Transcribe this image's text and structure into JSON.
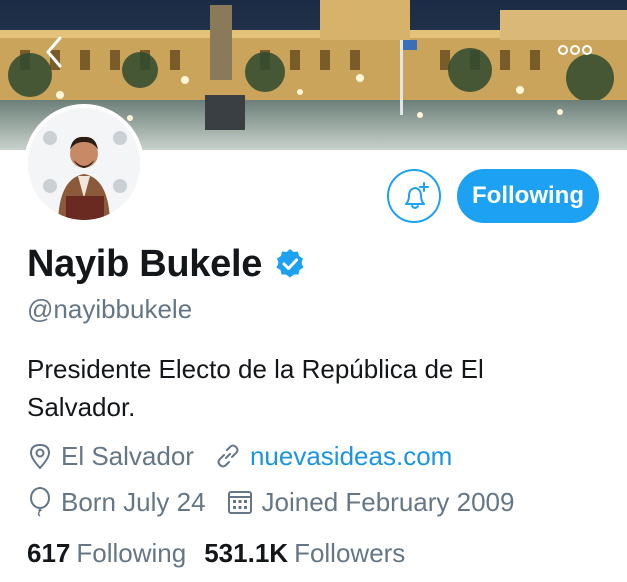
{
  "profile": {
    "display_name": "Nayib Bukele",
    "handle": "@nayibbukele",
    "bio": "Presidente Electo de la República de El Salvador.",
    "location": "El Salvador",
    "website": "nuevasideas.com",
    "born": "Born July 24",
    "joined": "Joined February 2009"
  },
  "actions": {
    "follow_label": "Following"
  },
  "stats": {
    "following_count": "617",
    "following_label": "Following",
    "followers_count": "531.1K",
    "followers_label": "Followers"
  },
  "icons": {
    "back": "chevron-left-icon",
    "more": "more-horizontal-icon",
    "notify": "bell-plus-icon",
    "verified": "verified-badge-icon",
    "location": "location-pin-icon",
    "link": "link-icon",
    "birthday": "balloon-icon",
    "calendar": "calendar-icon"
  },
  "colors": {
    "accent": "#1da1f2",
    "link": "#1b95e0",
    "text": "#14171a",
    "secondary": "#657786"
  }
}
